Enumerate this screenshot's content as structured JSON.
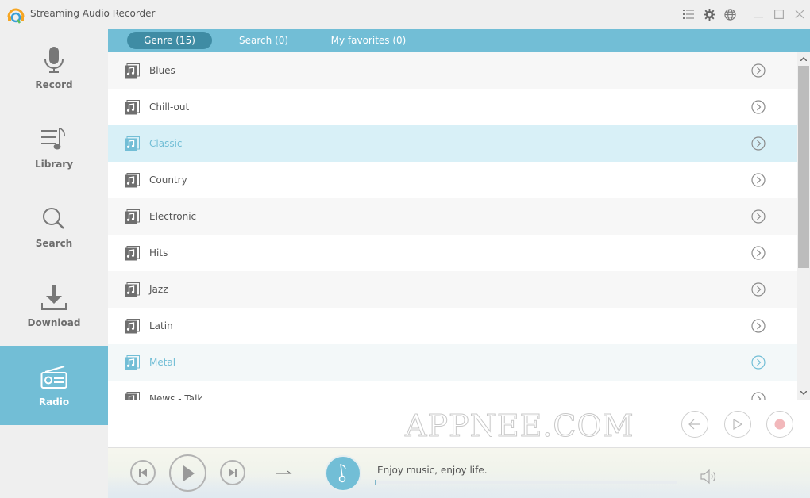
{
  "window": {
    "title": "Streaming Audio Recorder",
    "icons": [
      "menu-list-icon",
      "gear-icon",
      "globe-icon",
      "minimize-icon",
      "maximize-icon",
      "close-icon"
    ]
  },
  "sidebar": {
    "items": [
      {
        "label": "Record",
        "icon": "microphone-icon",
        "active": false
      },
      {
        "label": "Library",
        "icon": "music-library-icon",
        "active": false
      },
      {
        "label": "Search",
        "icon": "search-icon",
        "active": false
      },
      {
        "label": "Download",
        "icon": "download-icon",
        "active": false
      },
      {
        "label": "Radio",
        "icon": "radio-icon",
        "active": true
      }
    ]
  },
  "tabs": [
    {
      "label": "Genre (15)",
      "active": true
    },
    {
      "label": "Search (0)",
      "active": false
    },
    {
      "label": "My favorites (0)",
      "active": false
    }
  ],
  "genres": [
    {
      "name": "Blues",
      "state": "normal"
    },
    {
      "name": "Chill-out",
      "state": "normal"
    },
    {
      "name": "Classic",
      "state": "selected"
    },
    {
      "name": "Country",
      "state": "normal"
    },
    {
      "name": "Electronic",
      "state": "normal"
    },
    {
      "name": "Hits",
      "state": "normal"
    },
    {
      "name": "Jazz",
      "state": "normal"
    },
    {
      "name": "Latin",
      "state": "normal"
    },
    {
      "name": "Metal",
      "state": "hover"
    },
    {
      "name": "News - Talk",
      "state": "normal"
    }
  ],
  "actionbar": {
    "watermark": "APPNEE.COM",
    "buttons": [
      "back-button",
      "play-station-button",
      "record-button"
    ]
  },
  "player": {
    "now_playing": "Enjoy music, enjoy life.",
    "progress": 0
  },
  "colors": {
    "accent": "#72bed6",
    "accent_dark": "#3f8ca4",
    "selected_row": "#d8f0f7",
    "record_red": "#f2b8bb"
  }
}
